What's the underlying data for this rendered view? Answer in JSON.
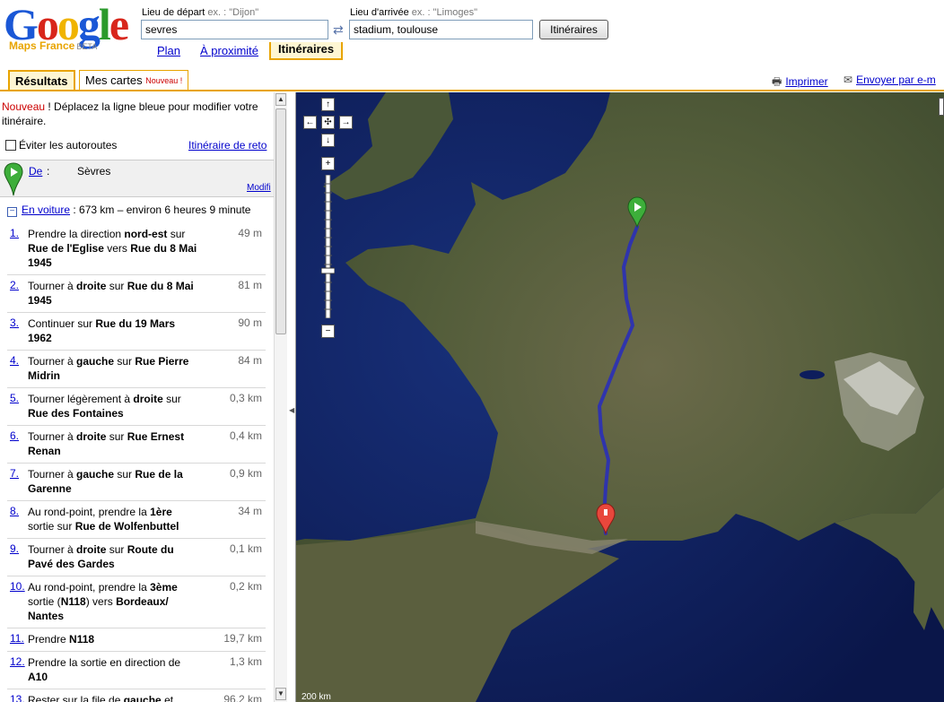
{
  "header": {
    "logo_text": "Google",
    "logo_sub": "Maps France",
    "logo_beta": "BETA",
    "start_label": "Lieu de départ",
    "start_example": "ex. : \"Dijon\"",
    "start_value": "sevres",
    "end_label": "Lieu d'arrivée",
    "end_example": "ex. : \"Limoges\"",
    "end_value": "stadium, toulouse",
    "swap_symbol": "⇄",
    "submit_label": "Itinéraires",
    "tabs": [
      "Plan",
      "À proximité",
      "Itinéraires"
    ]
  },
  "result_tabs": {
    "results": "Résultats",
    "my_maps": "Mes cartes",
    "my_maps_badge": "Nouveau !",
    "print": "Imprimer",
    "send": "Envoyer par e-m"
  },
  "panel": {
    "notice_new": "Nouveau",
    "notice_text": " ! Déplacez la ligne bleue pour modifier votre itinéraire.",
    "avoid_highways": "Éviter les autoroutes",
    "return_route": "Itinéraire de reto",
    "from_label": "De",
    "from_colon": ":",
    "from_city": "Sèvres",
    "modify": "Modifi",
    "drive_link": "En voiture",
    "drive_summary": " : 673 km – environ 6 heures 9 minute"
  },
  "steps": [
    {
      "num": "1.",
      "html": "Prendre la direction <b>nord-est</b> sur <b>Rue de l'Eglise</b> vers <b>Rue du 8 Mai 1945</b>",
      "dist": "49 m"
    },
    {
      "num": "2.",
      "html": "Tourner à <b>droite</b> sur <b>Rue du 8 Mai 1945</b>",
      "dist": "81 m"
    },
    {
      "num": "3.",
      "html": "Continuer sur <b>Rue du 19 Mars 1962</b>",
      "dist": "90 m"
    },
    {
      "num": "4.",
      "html": "Tourner à <b>gauche</b> sur <b>Rue Pierre Midrin</b>",
      "dist": "84 m"
    },
    {
      "num": "5.",
      "html": "Tourner légèrement à <b>droite</b> sur <b>Rue des Fontaines</b>",
      "dist": "0,3 km"
    },
    {
      "num": "6.",
      "html": "Tourner à <b>droite</b> sur <b>Rue Ernest Renan</b>",
      "dist": "0,4 km"
    },
    {
      "num": "7.",
      "html": "Tourner à <b>gauche</b> sur <b>Rue de la Garenne</b>",
      "dist": "0,9 km"
    },
    {
      "num": "8.",
      "html": "Au rond-point, prendre la <b>1ère</b> sortie sur <b>Rue de Wolfenbuttel</b>",
      "dist": "34 m"
    },
    {
      "num": "9.",
      "html": "Tourner à <b>droite</b> sur <b>Route du Pavé des Gardes</b>",
      "dist": "0,1 km"
    },
    {
      "num": "10.",
      "html": "Au rond-point, prendre la <b>3ème</b> sortie (<b>N118</b>) vers <b>Bordeaux/ Nantes</b>",
      "dist": "0,2 km"
    },
    {
      "num": "11.",
      "html": "Prendre <b>N118</b>",
      "dist": "19,7 km"
    },
    {
      "num": "12.",
      "html": "Prendre la sortie en direction de <b>A10</b>",
      "dist": "1,3 km"
    },
    {
      "num": "13.",
      "html": "Rester sur la file de <b>gauche</b> et suivre <b>Chartres/Nantes/Orléans/</b>",
      "dist": "96,2 km"
    }
  ],
  "map": {
    "scale_text": "200 km",
    "colors": {
      "sea": "#0d1d5c",
      "land": "#4f5a3a",
      "route": "#2a2fb8",
      "start_marker": "#3dae3a",
      "end_marker": "#e8473c"
    }
  }
}
